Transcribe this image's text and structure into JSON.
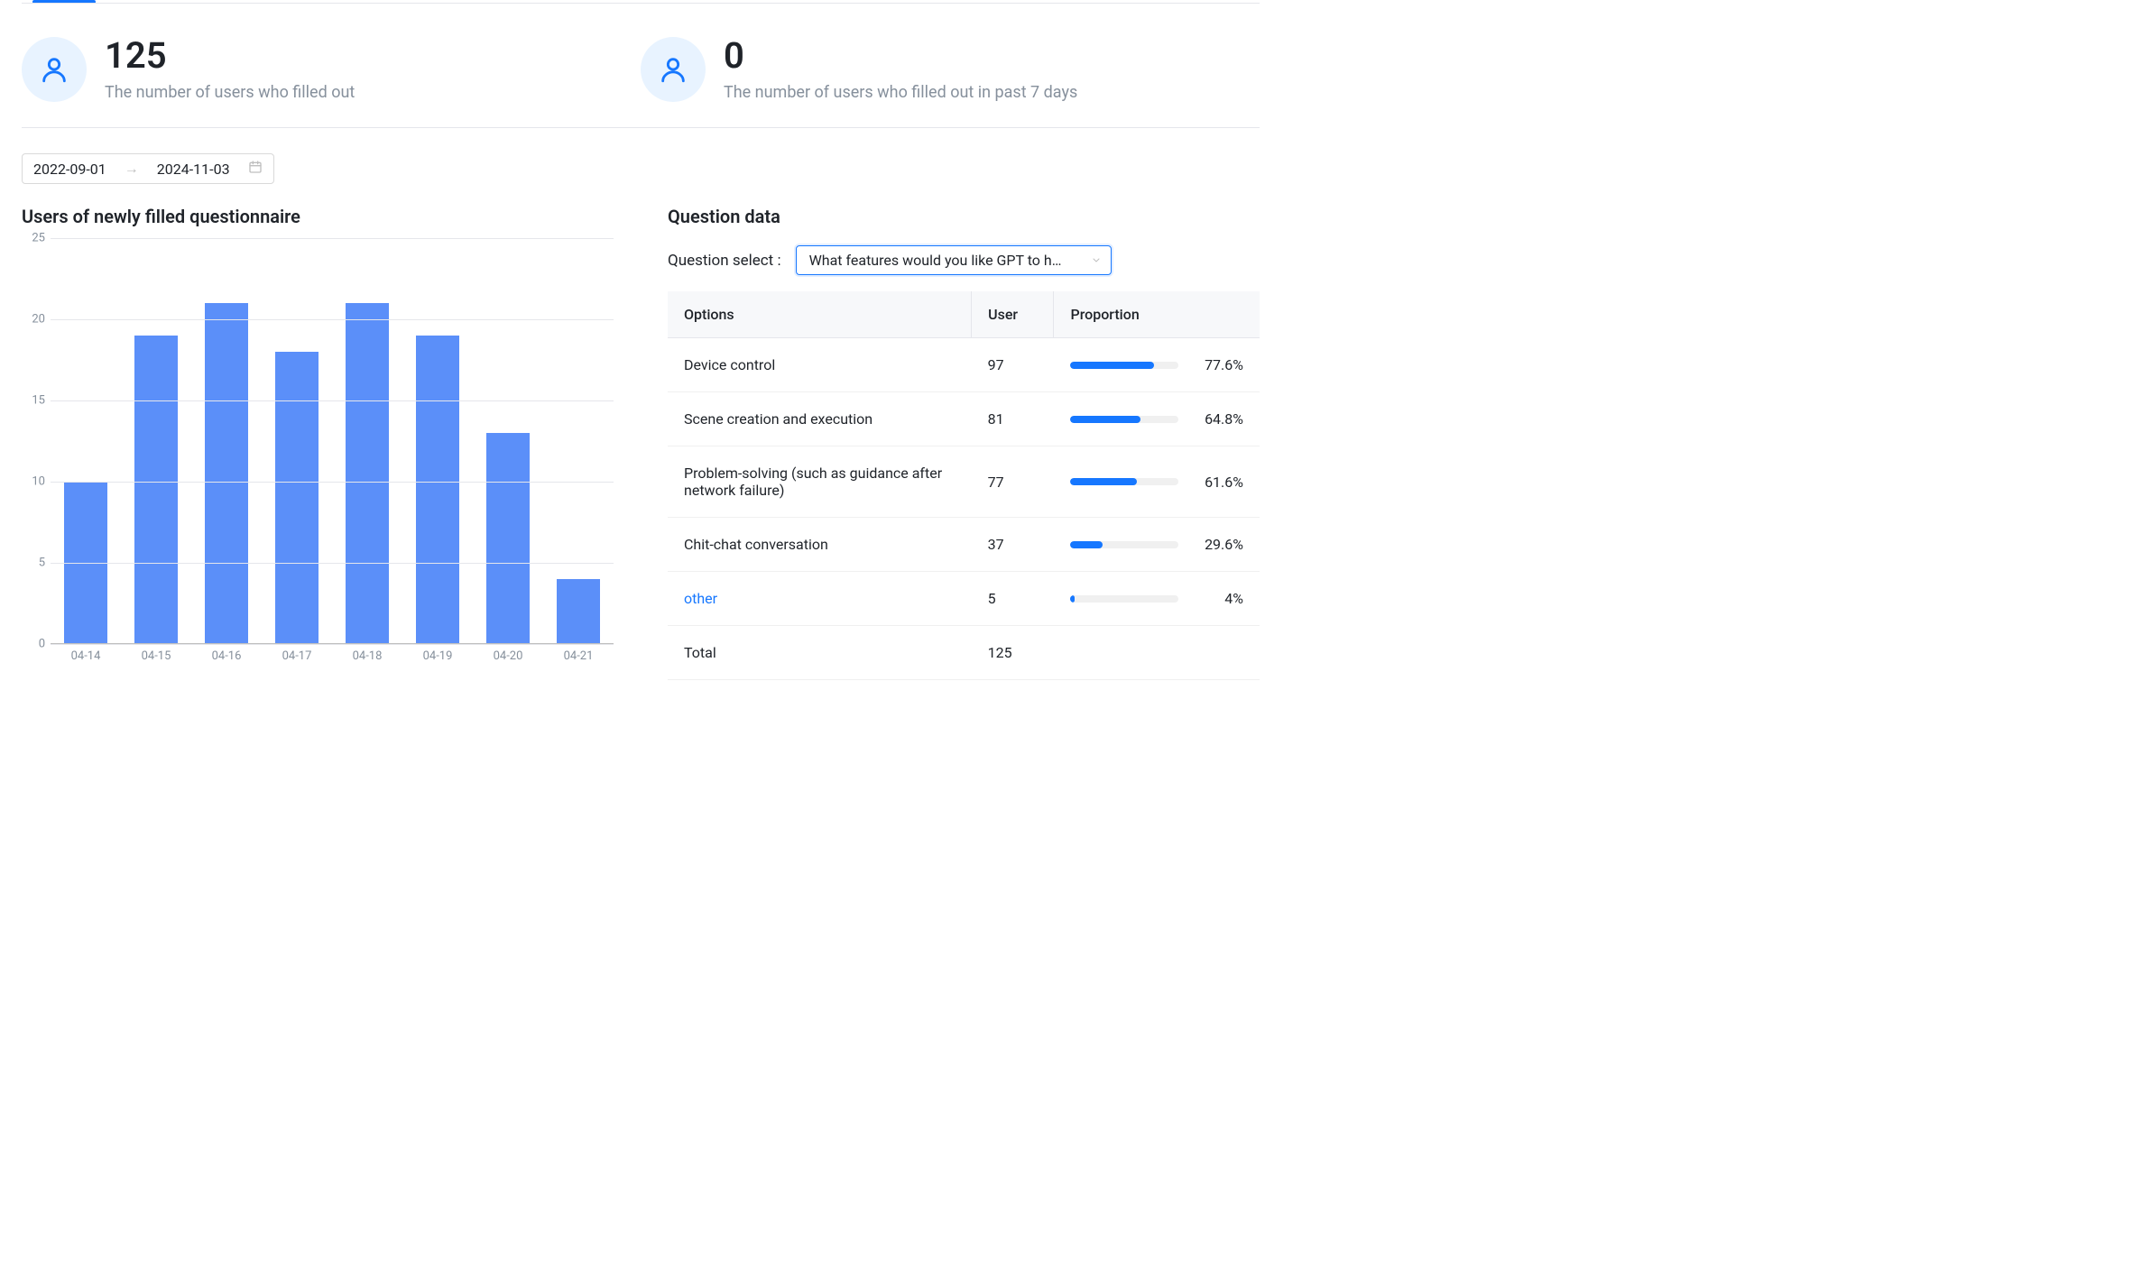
{
  "colors": {
    "accent": "#1677ff",
    "bar": "#5b8ff9"
  },
  "stats": {
    "total": {
      "value": "125",
      "label": "The number of users who filled out"
    },
    "recent": {
      "value": "0",
      "label": "The number of users who filled out in past 7 days"
    }
  },
  "date_range": {
    "start": "2022-09-01",
    "end": "2024-11-03"
  },
  "chart_title": "Users of newly filled questionnaire",
  "chart_data": {
    "type": "bar",
    "title": "Users of newly filled questionnaire",
    "xlabel": "",
    "ylabel": "",
    "ylim": [
      0,
      25
    ],
    "yticks": [
      0,
      5,
      10,
      15,
      20,
      25
    ],
    "categories": [
      "04-14",
      "04-15",
      "04-16",
      "04-17",
      "04-18",
      "04-19",
      "04-20",
      "04-21"
    ],
    "values": [
      10,
      19,
      21,
      18,
      21,
      19,
      13,
      4
    ]
  },
  "question_section_title": "Question data",
  "question_select": {
    "label": "Question select :",
    "selected": "What features would you like GPT to h…"
  },
  "table": {
    "headers": {
      "options": "Options",
      "user": "User",
      "proportion": "Proportion"
    },
    "rows": [
      {
        "option": "Device control",
        "user": "97",
        "pct": 77.6,
        "pct_label": "77.6%",
        "link": false
      },
      {
        "option": "Scene creation and execution",
        "user": "81",
        "pct": 64.8,
        "pct_label": "64.8%",
        "link": false
      },
      {
        "option": "Problem-solving (such as guidance after network failure)",
        "user": "77",
        "pct": 61.6,
        "pct_label": "61.6%",
        "link": false
      },
      {
        "option": "Chit-chat conversation",
        "user": "37",
        "pct": 29.6,
        "pct_label": "29.6%",
        "link": false
      },
      {
        "option": "other",
        "user": "5",
        "pct": 4,
        "pct_label": "4%",
        "link": true
      }
    ],
    "total_row": {
      "label": "Total",
      "user": "125"
    }
  }
}
